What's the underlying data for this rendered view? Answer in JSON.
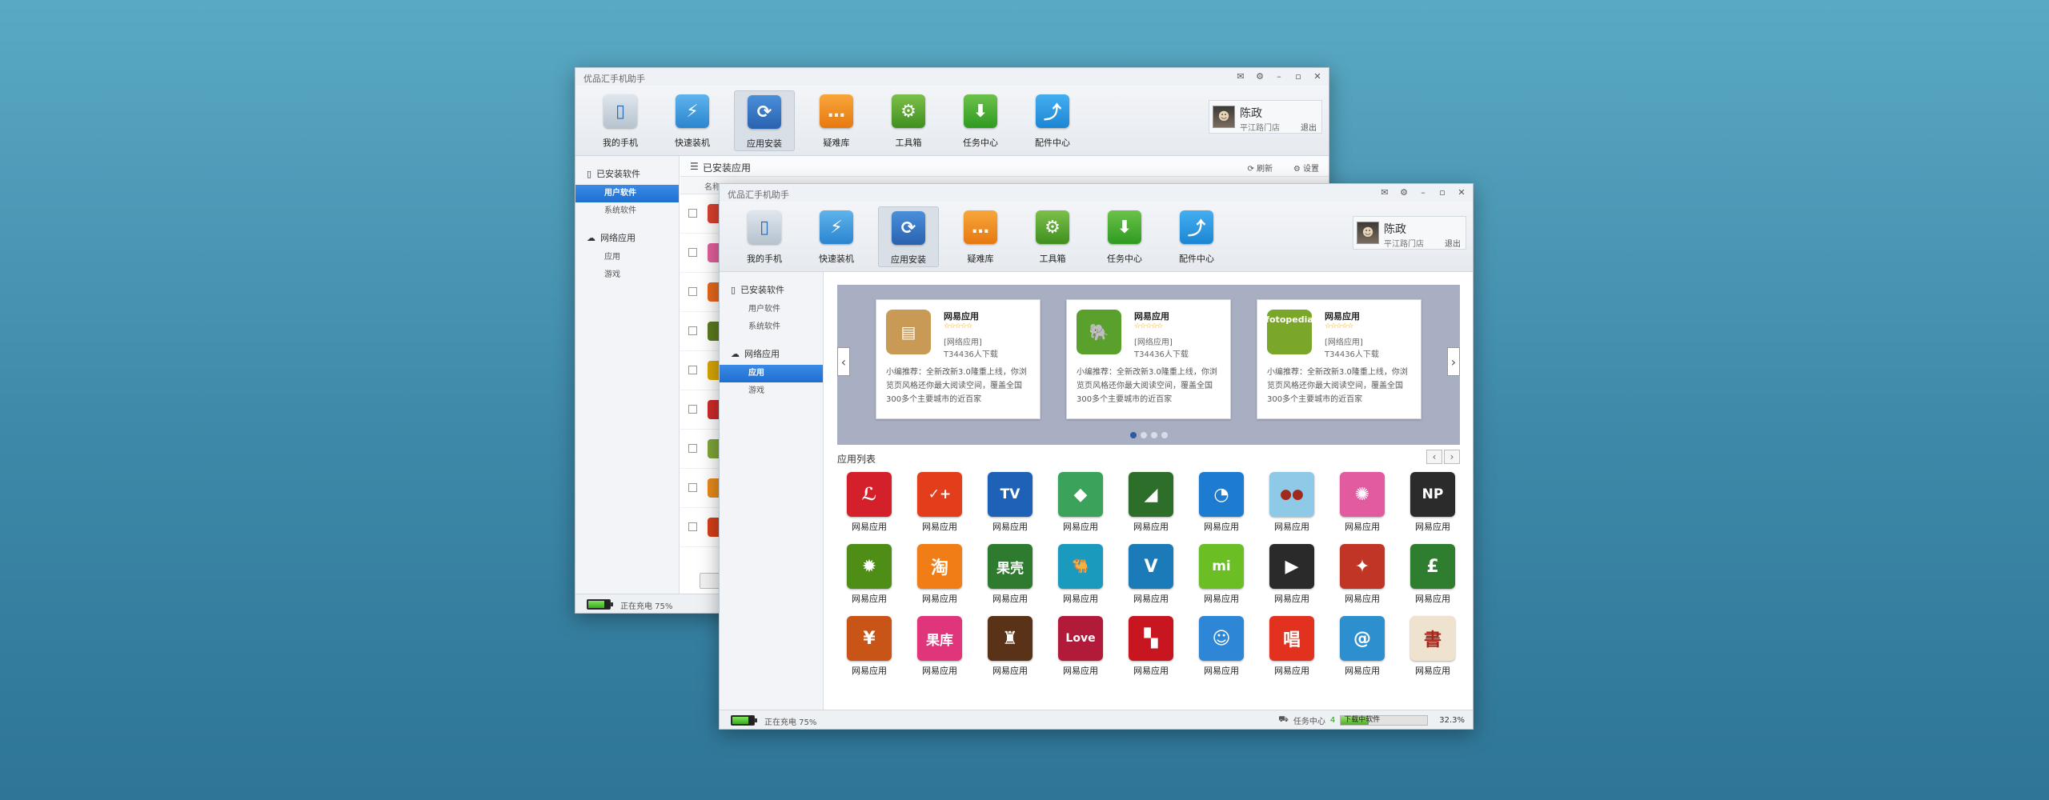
{
  "app_title": "优品汇手机助手",
  "toolbar": [
    {
      "label": "我的手机",
      "icon": "phone-icon",
      "glyph": "▯",
      "cls": "t-phone"
    },
    {
      "label": "快速装机",
      "icon": "flash-install-icon",
      "glyph": "⚡",
      "cls": "t-flash"
    },
    {
      "label": "应用安装",
      "icon": "refresh-install-icon",
      "glyph": "⟳",
      "cls": "t-app"
    },
    {
      "label": "疑难库",
      "icon": "chat-bubble-icon",
      "glyph": "…",
      "cls": "t-faq"
    },
    {
      "label": "工具箱",
      "icon": "toolbox-icon",
      "glyph": "⚙",
      "cls": "t-tool"
    },
    {
      "label": "任务中心",
      "icon": "task-inbox-icon",
      "glyph": "⬇",
      "cls": "t-task"
    },
    {
      "label": "配件中心",
      "icon": "share-icon",
      "glyph": "⤴",
      "cls": "t-acc"
    }
  ],
  "user": {
    "name": "陈政",
    "store": "平江路门店",
    "logout": "退出"
  },
  "sidebar": {
    "group_installed": "已安装软件",
    "item_user": "用户软件",
    "item_system": "系统软件",
    "group_online": "网络应用",
    "item_apps": "应用",
    "item_games": "游戏"
  },
  "back": {
    "header_title": "已安装应用",
    "refresh": "刷新",
    "settings": "设置",
    "col_name": "名称",
    "row_colors": [
      "#d9412e",
      "#e0609b",
      "#e5671c",
      "#5a7a1f",
      "#d6a700",
      "#cc2a2a",
      "#7fa43a",
      "#e68a1b",
      "#d43f1a"
    ]
  },
  "status": {
    "charging": "正在充电 75%",
    "battery_level": 0.75,
    "task_center": "任务中心",
    "task_count": "4",
    "downloading": "下载中软件",
    "progress_pct": "32.3%",
    "progress_value": 0.323
  },
  "banner": {
    "cards": [
      {
        "name": "网易应用",
        "stars": "☆☆☆☆☆",
        "category": "[网络应用]",
        "downloads": "T34436人下载",
        "desc": "小编推荐：全新改新3.0隆重上线，你浏 览页风格还你最大阅读空间，覆盖全国 300多个主要城市的近百家",
        "icon": "radio-app-icon",
        "glyph": "▤",
        "color": "#c89a55"
      },
      {
        "name": "网易应用",
        "stars": "☆☆☆☆☆",
        "category": "[网络应用]",
        "downloads": "T34436人下载",
        "desc": "小编推荐：全新改新3.0隆重上线，你浏 览页风格还你最大阅读空间，覆盖全国 300多个主要城市的近百家",
        "icon": "evernote-icon",
        "glyph": "🐘",
        "color": "#5aa02c"
      },
      {
        "name": "网易应用",
        "stars": "☆☆☆☆☆",
        "category": "[网络应用]",
        "downloads": "T34436人下载",
        "desc": "小编推荐：全新改新3.0隆重上线，你浏 览页风格还你最大阅读空间，覆盖全国 300多个主要城市的近百家",
        "icon": "fotopedia-icon",
        "glyph": "fotopedia",
        "color": "#7aa62a"
      }
    ],
    "dots": 4
  },
  "list_title": "应用列表",
  "apps": [
    {
      "name": "网易应用",
      "glyph": "ℒ",
      "color": "#d3202a"
    },
    {
      "name": "网易应用",
      "glyph": "✓+",
      "color": "#e23e1c"
    },
    {
      "name": "网易应用",
      "glyph": "TV",
      "color": "#1e62b8"
    },
    {
      "name": "网易应用",
      "glyph": "◆",
      "color": "#3aa25a"
    },
    {
      "name": "网易应用",
      "glyph": "◢",
      "color": "#2d6e2a"
    },
    {
      "name": "网易应用",
      "glyph": "◔",
      "color": "#1d7bd0"
    },
    {
      "name": "网易应用",
      "glyph": "●●",
      "color": "#8fc9e8"
    },
    {
      "name": "网易应用",
      "glyph": "✺",
      "color": "#e25aa0"
    },
    {
      "name": "网易应用",
      "glyph": "NP",
      "color": "#2b2b2b"
    },
    {
      "name": "网易应用",
      "glyph": "✹",
      "color": "#4e8d16"
    },
    {
      "name": "网易应用",
      "glyph": "淘",
      "color": "#f07d16"
    },
    {
      "name": "网易应用",
      "glyph": "果壳",
      "color": "#2e7a2e"
    },
    {
      "name": "网易应用",
      "glyph": "🐫",
      "color": "#1a9bbd"
    },
    {
      "name": "网易应用",
      "glyph": "V",
      "color": "#1b7bb8"
    },
    {
      "name": "网易应用",
      "glyph": "mi",
      "color": "#6bbf24"
    },
    {
      "name": "网易应用",
      "glyph": "▶",
      "color": "#2a2a2a"
    },
    {
      "name": "网易应用",
      "glyph": "✦",
      "color": "#c03526"
    },
    {
      "name": "网易应用",
      "glyph": "£",
      "color": "#2f7d2f"
    },
    {
      "name": "网易应用",
      "glyph": "¥",
      "color": "#c85517"
    },
    {
      "name": "网易应用",
      "glyph": "果库",
      "color": "#e0357a"
    },
    {
      "name": "网易应用",
      "glyph": "♜",
      "color": "#5a3217"
    },
    {
      "name": "网易应用",
      "glyph": "Love",
      "color": "#b21a3a"
    },
    {
      "name": "网易应用",
      "glyph": "▚",
      "color": "#c7161f"
    },
    {
      "name": "网易应用",
      "glyph": "☺",
      "color": "#2d86d6"
    },
    {
      "name": "网易应用",
      "glyph": "唱",
      "color": "#e2321f"
    },
    {
      "name": "网易应用",
      "glyph": "@",
      "color": "#2e8fcf"
    },
    {
      "name": "网易应用",
      "glyph": "書",
      "color": "#efe2cf"
    }
  ]
}
